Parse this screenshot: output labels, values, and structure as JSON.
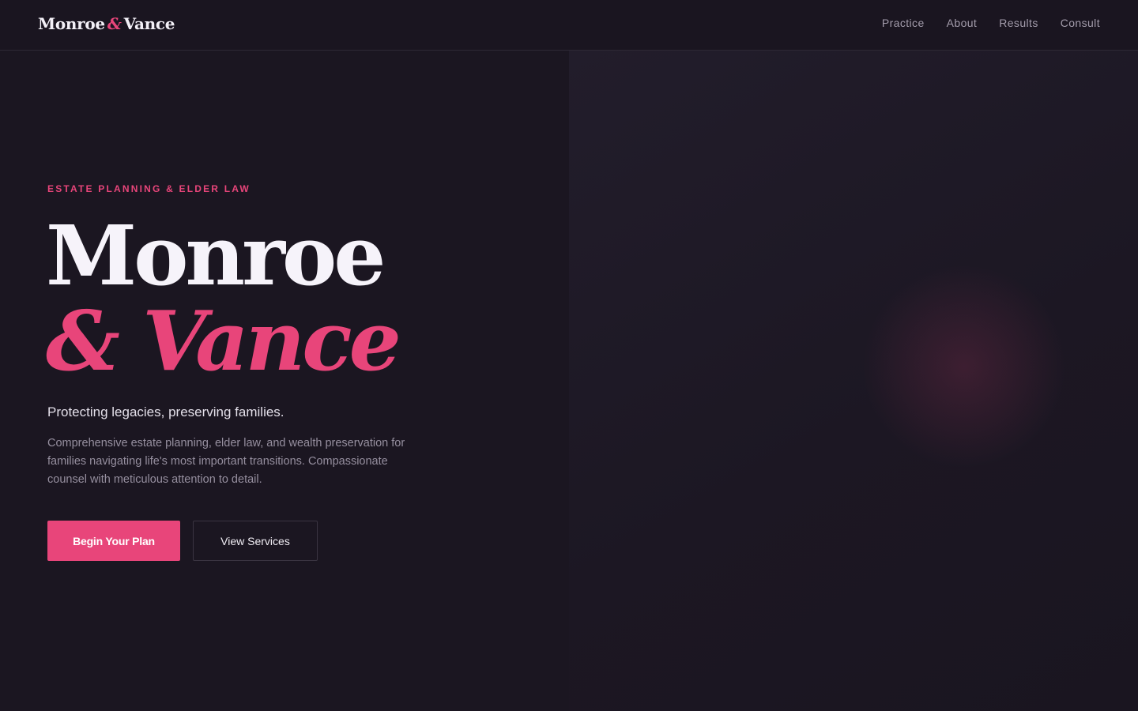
{
  "header": {
    "logo_left": "Monroe",
    "logo_amp": "&",
    "logo_right": "Vance",
    "nav": [
      "Practice",
      "About",
      "Results",
      "Consult"
    ]
  },
  "hero": {
    "eyebrow": "ESTATE PLANNING & ELDER LAW",
    "title_line1": "Monroe",
    "title_line2": "& Vance",
    "tagline": "Protecting legacies, preserving families.",
    "description": "Comprehensive estate planning, elder law, and wealth preservation for families navigating life's most important transitions. Compassionate counsel with meticulous attention to detail.",
    "primary_button": "Begin Your Plan",
    "secondary_button": "View Services"
  },
  "colors": {
    "accent": "#e8457a",
    "background": "#1b1621",
    "text_primary": "#f6f3fa",
    "text_muted": "#968f9f"
  }
}
